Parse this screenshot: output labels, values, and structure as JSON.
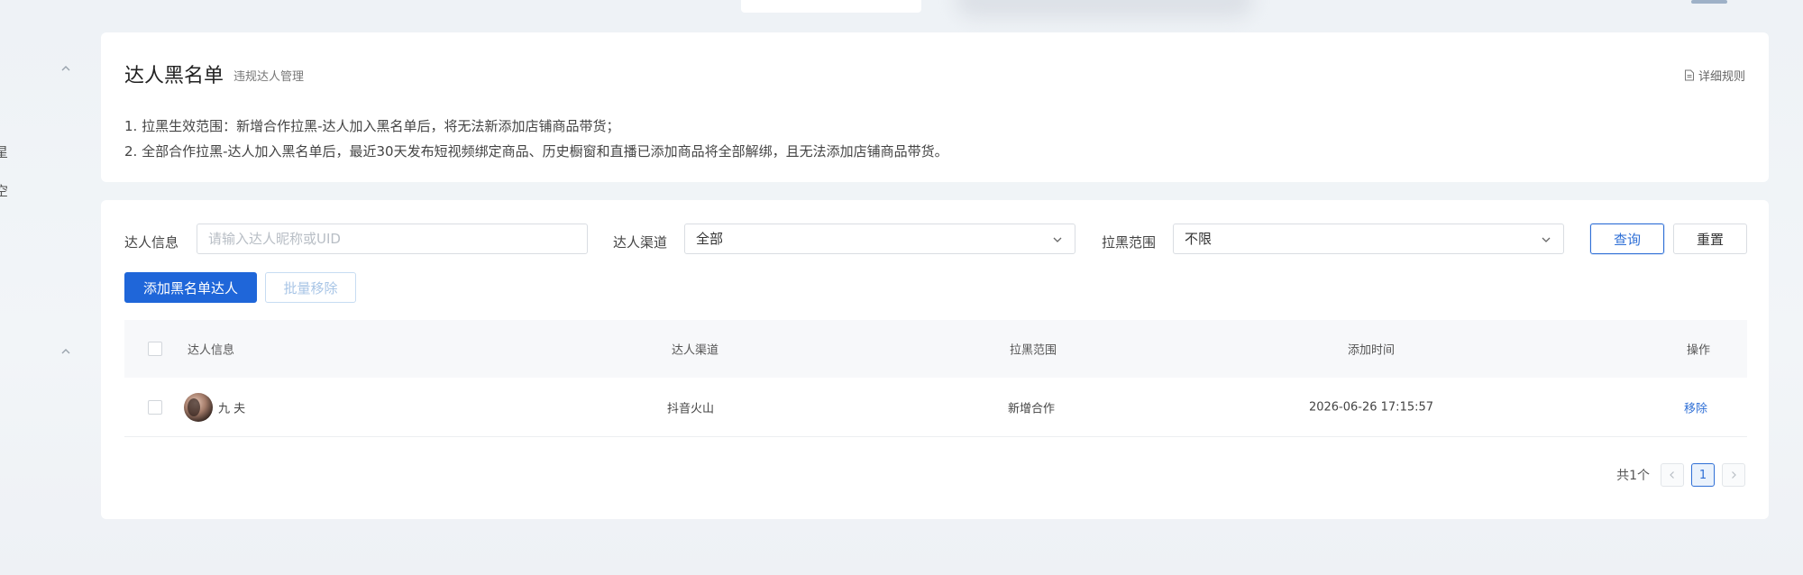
{
  "sidebar": {
    "cut_items": [
      "星",
      "空"
    ]
  },
  "header": {
    "title": "达人黑名单",
    "subtitle": "违规达人管理",
    "rules_link": "详细规则",
    "rules": [
      "1. 拉黑生效范围：新增合作拉黑-达人加入黑名单后，将无法新添加店铺商品带货；",
      "2. 全部合作拉黑-达人加入黑名单后，最近30天发布短视频绑定商品、历史橱窗和直播已添加商品将全部解绑，且无法添加店铺商品带货。"
    ]
  },
  "filters": {
    "info_label": "达人信息",
    "info_placeholder": "请输入达人昵称或UID",
    "channel_label": "达人渠道",
    "channel_value": "全部",
    "scope_label": "拉黑范围",
    "scope_value": "不限",
    "query_button": "查询",
    "reset_button": "重置"
  },
  "actions": {
    "add_button": "添加黑名单达人",
    "batch_remove_button": "批量移除"
  },
  "table": {
    "headers": [
      "达人信息",
      "达人渠道",
      "拉黑范围",
      "添加时间",
      "操作"
    ],
    "rows": [
      {
        "name": "九  夫",
        "channel": "抖音火山",
        "scope": "新增合作",
        "time": "2026-06-26 17:15:57",
        "action": "移除"
      }
    ]
  },
  "pagination": {
    "total": "共1个",
    "current": "1"
  }
}
